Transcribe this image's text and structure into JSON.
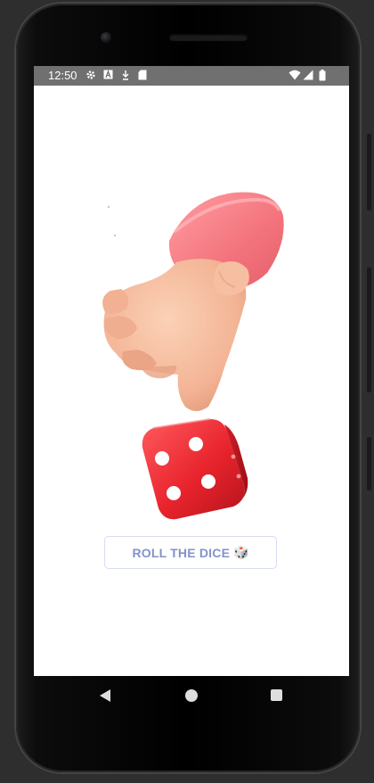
{
  "status_bar": {
    "time": "12:50",
    "left_icons": [
      "settings-icon",
      "a-box-icon",
      "download-icon",
      "sd-card-icon"
    ],
    "right_icons": [
      "wifi-icon",
      "signal-icon",
      "battery-icon"
    ]
  },
  "main": {
    "illustration": [
      "hand-illustration",
      "dice-illustration"
    ],
    "button_label": "ROLL THE DICE",
    "button_emoji": "🎲",
    "button_text_color": "#8293cc",
    "dice_color": "#e8242d"
  },
  "nav_bar": {
    "icons": [
      "back-icon",
      "home-icon",
      "recents-icon"
    ]
  }
}
